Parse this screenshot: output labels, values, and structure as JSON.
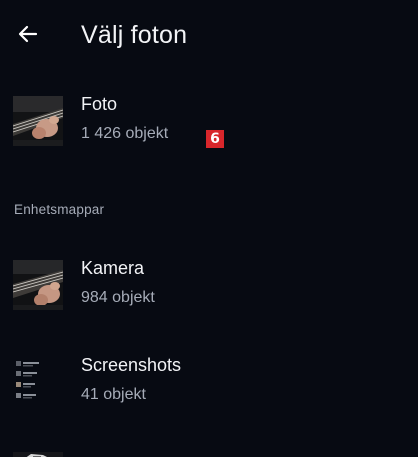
{
  "app_bar": {
    "back_icon": "arrow-left-icon",
    "title": "Välj foton"
  },
  "albums": [
    {
      "title": "Foto",
      "count": "1 426 objekt",
      "thumb_icon": "guitar-photo-thumbnail",
      "badge": "6"
    },
    {
      "title": "Kamera",
      "count": "984 objekt",
      "thumb_icon": "guitar-photo-thumbnail"
    },
    {
      "title": "Screenshots",
      "count": "41 objekt",
      "thumb_icon": "screenshot-thumbnail"
    }
  ],
  "section_header": "Enhetsmappar",
  "colors": {
    "background": "#070a12",
    "primary_text": "#f2f3f6",
    "secondary_text": "#a6acb8",
    "badge": "#d8262b"
  }
}
